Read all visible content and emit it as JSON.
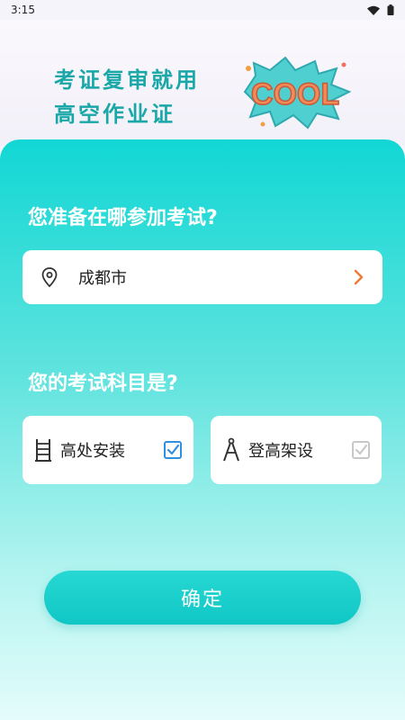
{
  "status_bar": {
    "time": "3:15"
  },
  "banner": {
    "line1": "考证复审就用",
    "line2": "高空作业证",
    "cool_text": "COOL"
  },
  "exam_location": {
    "question": "您准备在哪参加考试?",
    "city": "成都市"
  },
  "exam_subject": {
    "question": "您的考试科目是?",
    "options": [
      {
        "label": "高处安装",
        "checked": true
      },
      {
        "label": "登高架设",
        "checked": false
      }
    ]
  },
  "confirm_label": "确定",
  "colors": {
    "accent": "#10c7c5",
    "slogan": "#1aa7a8",
    "checked": "#2f8fe0",
    "unchecked": "#c8c8c8",
    "chevron": "#f07a3a"
  }
}
